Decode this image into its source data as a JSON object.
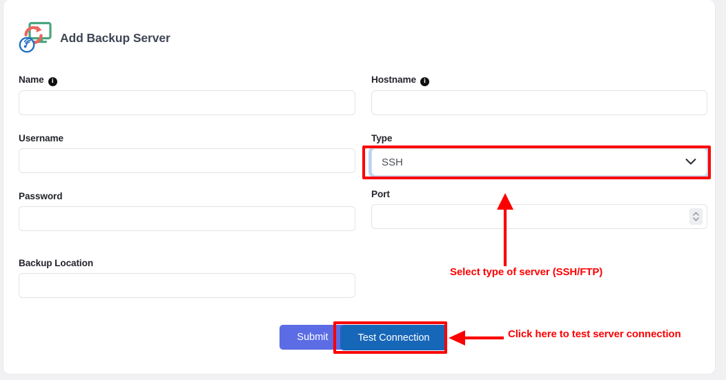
{
  "page": {
    "title": "Add Backup Server",
    "header_icon": "backup-server-icon"
  },
  "form": {
    "fields": [
      {
        "key": "name",
        "label": "Name",
        "has_info_icon": true,
        "info_icon_glyph": "i",
        "value": "",
        "placeholder": "",
        "control": "text"
      },
      {
        "key": "hostname",
        "label": "Hostname",
        "has_info_icon": true,
        "info_icon_glyph": "i",
        "value": "",
        "placeholder": "",
        "control": "text"
      },
      {
        "key": "username",
        "label": "Username",
        "has_info_icon": false,
        "value": "",
        "placeholder": "",
        "control": "text"
      },
      {
        "key": "type",
        "label": "Type",
        "has_info_icon": false,
        "value": "SSH",
        "control": "select",
        "options": [
          "SSH",
          "FTP"
        ]
      },
      {
        "key": "password",
        "label": "Password",
        "has_info_icon": false,
        "value": "",
        "placeholder": "",
        "control": "password"
      },
      {
        "key": "port",
        "label": "Port",
        "has_info_icon": false,
        "value": "",
        "placeholder": "",
        "control": "number"
      },
      {
        "key": "backup_location",
        "label": "Backup Location",
        "has_info_icon": false,
        "value": "",
        "placeholder": "",
        "control": "text"
      }
    ]
  },
  "buttons": {
    "submit": "Submit",
    "test_connection": "Test Connection"
  },
  "annotations": [
    {
      "key": "type_note",
      "text": "Select type of server (SSH/FTP)",
      "target": "type-select"
    },
    {
      "key": "test_note",
      "text": "Click here to test server connection",
      "target": "test-connection-button"
    }
  ],
  "colors": {
    "annotation_red": "#fc0000",
    "submit_button": "#5b6ce4",
    "test_button": "#1767b8",
    "focus_ring": "#b9d4f6",
    "page_background": "#f1f1f4",
    "card_background": "#ffffff",
    "label_text": "#23252b",
    "title_text": "#3f4654"
  }
}
